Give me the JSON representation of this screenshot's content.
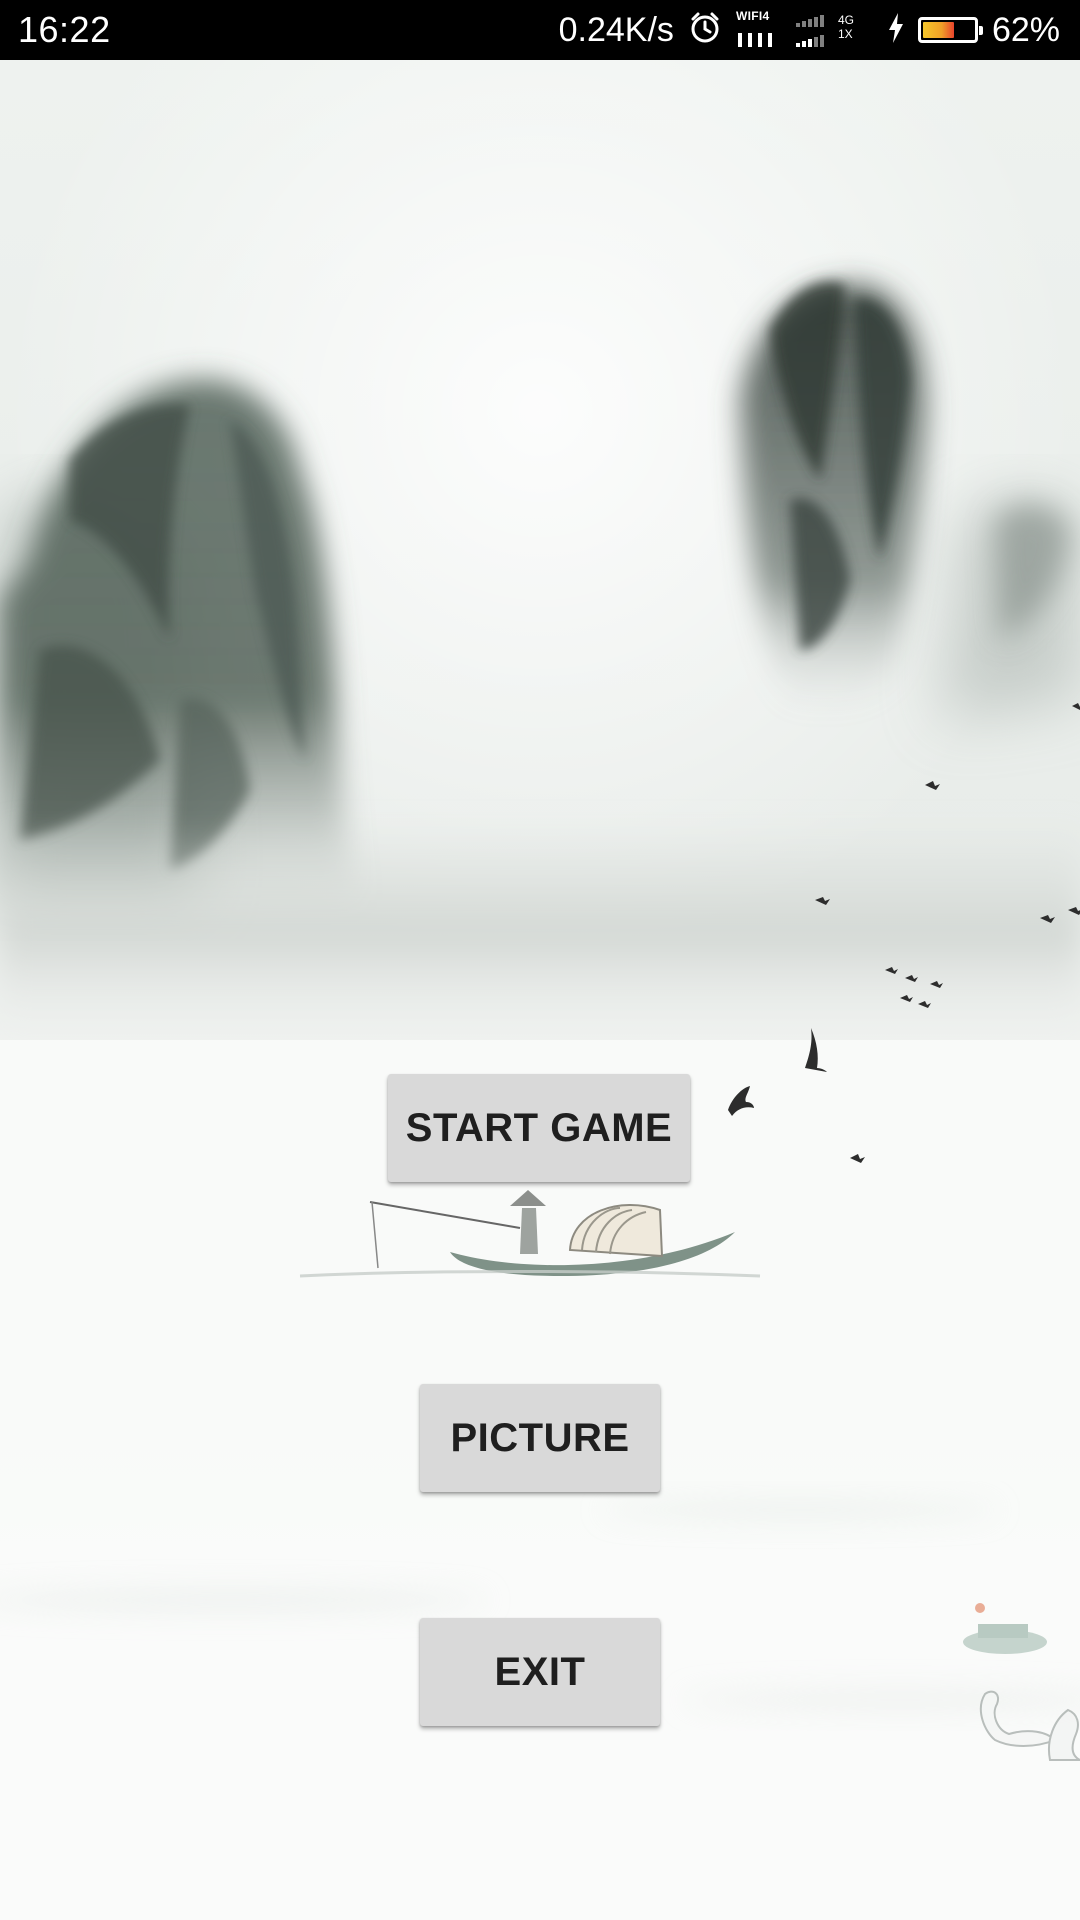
{
  "status_bar": {
    "time": "16:22",
    "net_speed": "0.24K/s",
    "wifi_label": "WIFI4",
    "network_type": "4G",
    "sim_slot": "1X",
    "battery_percent": "62%",
    "battery_level": 0.62,
    "icons": [
      "alarm-icon",
      "wifi-icon",
      "signal-icon",
      "charging-icon",
      "battery-icon"
    ]
  },
  "menu": {
    "start_label": "START GAME",
    "picture_label": "PICTURE",
    "exit_label": "EXIT"
  },
  "colors": {
    "status_bar_bg": "#000000",
    "button_bg": "#d9d9d9",
    "button_text": "#1f1f1f",
    "background_mist": "#f4f6f4"
  }
}
